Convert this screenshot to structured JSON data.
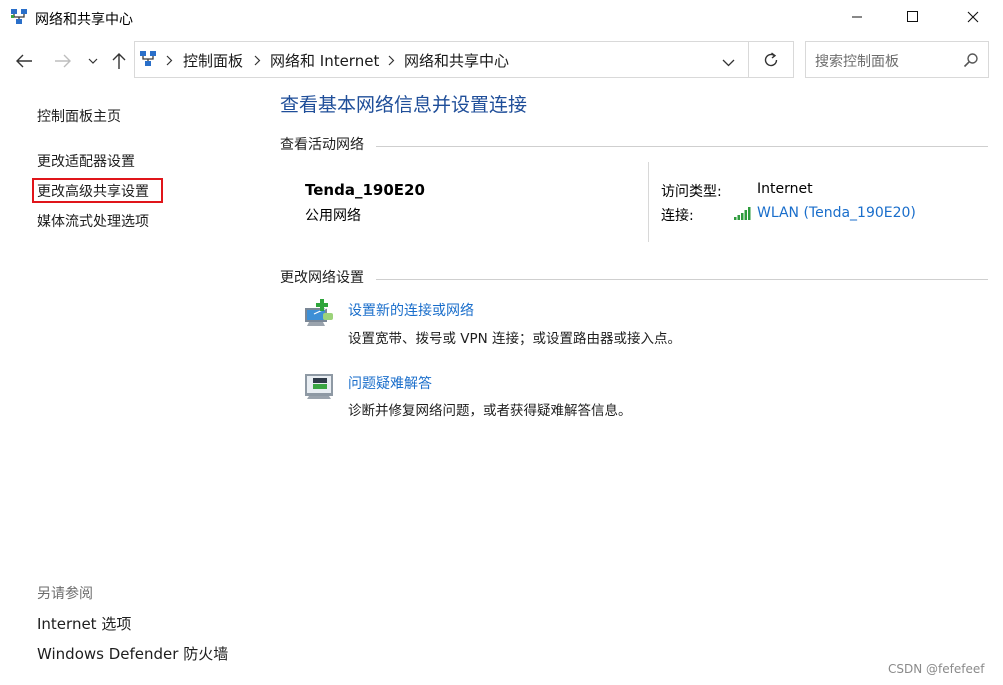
{
  "window": {
    "title": "网络和共享中心",
    "minimize_label": "minimize",
    "maximize_label": "maximize",
    "close_label": "close"
  },
  "breadcrumbs": [
    "控制面板",
    "网络和 Internet",
    "网络和共享中心"
  ],
  "search": {
    "placeholder": "搜索控制面板"
  },
  "sidebar": {
    "items": [
      {
        "label": "控制面板主页"
      },
      {
        "label": "更改适配器设置"
      },
      {
        "label": "更改高级共享设置"
      },
      {
        "label": "媒体流式处理选项"
      }
    ],
    "see_also_heading": "另请参阅",
    "see_also": [
      {
        "label": "Internet 选项"
      },
      {
        "label": "Windows Defender 防火墙"
      }
    ]
  },
  "main": {
    "heading": "查看基本网络信息并设置连接",
    "active_section": "查看活动网络",
    "network": {
      "name": "Tenda_190E20",
      "category": "公用网络",
      "access_type_label": "访问类型:",
      "access_type_value": "Internet",
      "connection_label": "连接:",
      "connection_value": "WLAN (Tenda_190E20)"
    },
    "change_section": "更改网络设置",
    "tasks": [
      {
        "title": "设置新的连接或网络",
        "desc": "设置宽带、拨号或 VPN 连接；或设置路由器或接入点。"
      },
      {
        "title": "问题疑难解答",
        "desc": "诊断并修复网络问题，或者获得疑难解答信息。"
      }
    ]
  },
  "watermark": "CSDN @fefefeef",
  "colors": {
    "link": "#1a6ecb",
    "heading": "#1f4e99",
    "highlight_box": "#e0151a"
  }
}
